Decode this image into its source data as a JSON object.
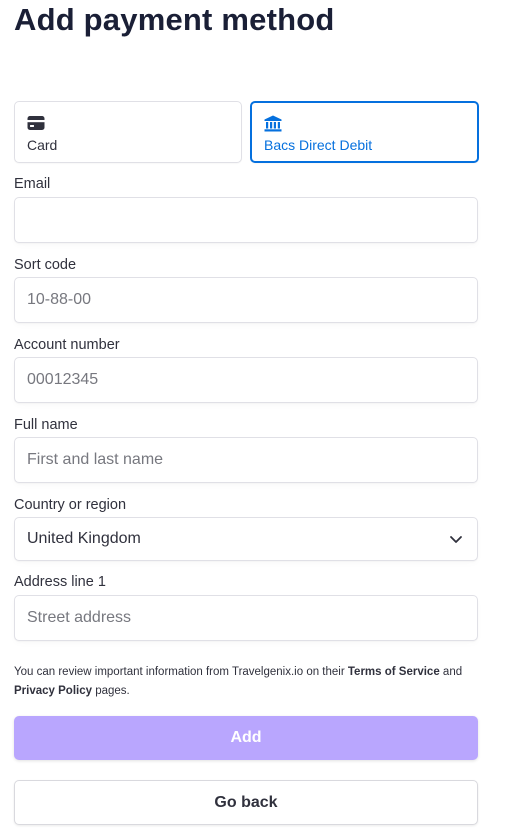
{
  "page": {
    "title": "Add payment method"
  },
  "tabs": [
    {
      "label": "Card",
      "icon": "card-icon",
      "selected": false
    },
    {
      "label": "Bacs Direct Debit",
      "icon": "bank-icon",
      "selected": true
    }
  ],
  "form": {
    "email": {
      "label": "Email",
      "value": "",
      "placeholder": ""
    },
    "sort_code": {
      "label": "Sort code",
      "value": "",
      "placeholder": "10-88-00"
    },
    "account_number": {
      "label": "Account number",
      "value": "",
      "placeholder": "00012345"
    },
    "full_name": {
      "label": "Full name",
      "value": "",
      "placeholder": "First and last name"
    },
    "country": {
      "label": "Country or region",
      "value": "United Kingdom",
      "icon": "chevron-down-icon"
    },
    "address_line1": {
      "label": "Address line 1",
      "value": "",
      "placeholder": "Street address"
    }
  },
  "notice": {
    "part1": "You can review important information from Travelgenix.io on their ",
    "terms": "Terms of Service",
    "part2": " and ",
    "privacy": "Privacy Policy",
    "part3": " pages."
  },
  "buttons": {
    "add": "Add",
    "back": "Go back"
  },
  "colors": {
    "accent": "#0570de",
    "add_button": "#b9a6fe",
    "title": "#1a1f36",
    "text": "#30313d"
  }
}
